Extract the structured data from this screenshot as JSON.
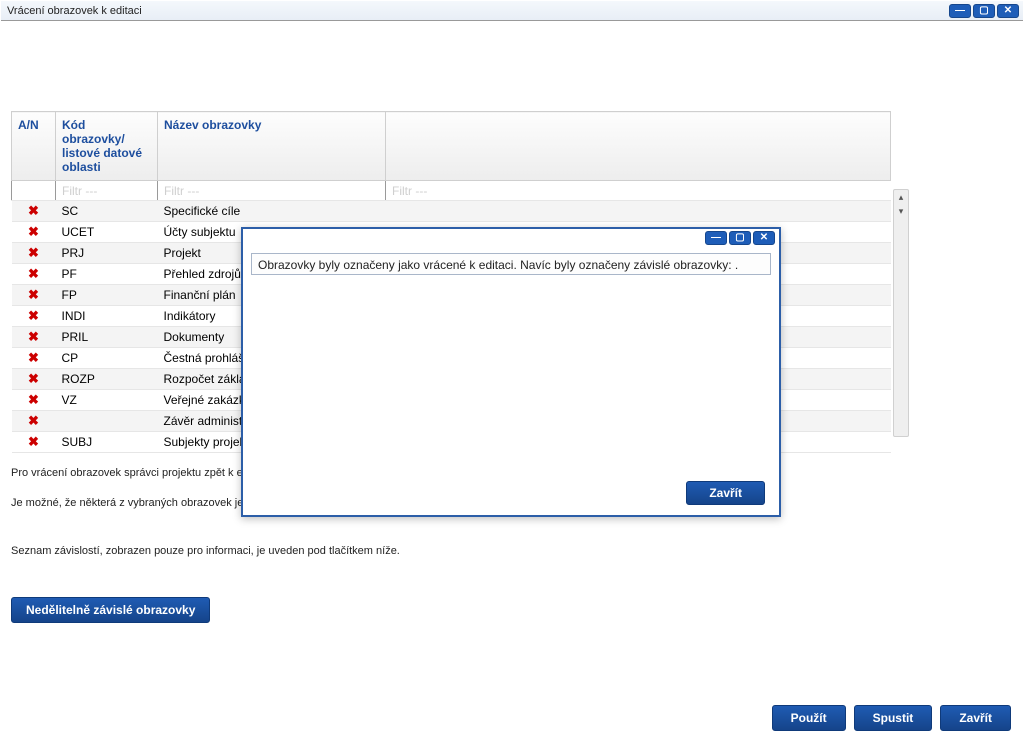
{
  "window": {
    "title": "Vrácení obrazovek k editaci"
  },
  "table": {
    "headers": {
      "an": "A/N",
      "kod": "Kód obrazovky/ listové datové oblasti",
      "nazev": "Název obrazovky"
    },
    "filter_label": "Filtr ---",
    "rows": [
      {
        "mark": "✖",
        "kod": "SC",
        "nazev": "Specifické cíle"
      },
      {
        "mark": "✖",
        "kod": "UCET",
        "nazev": "Účty subjektu"
      },
      {
        "mark": "✖",
        "kod": "PRJ",
        "nazev": "Projekt"
      },
      {
        "mark": "✖",
        "kod": "PF",
        "nazev": "Přehled zdrojů"
      },
      {
        "mark": "✖",
        "kod": "FP",
        "nazev": "Finanční plán"
      },
      {
        "mark": "✖",
        "kod": "INDI",
        "nazev": "Indikátory"
      },
      {
        "mark": "✖",
        "kod": "PRIL",
        "nazev": "Dokumenty"
      },
      {
        "mark": "✖",
        "kod": "CP",
        "nazev": "Čestná prohlášení"
      },
      {
        "mark": "✖",
        "kod": "ROZP",
        "nazev": "Rozpočet základní"
      },
      {
        "mark": "✖",
        "kod": "VZ",
        "nazev": "Veřejné zakázky"
      },
      {
        "mark": "✖",
        "kod": "",
        "nazev": "Závěr administrativního ověření"
      },
      {
        "mark": "✖",
        "kod": "SUBJ",
        "nazev": "Subjekty projektu"
      }
    ]
  },
  "info": {
    "line1": "Pro vrácení obrazovek správci projektu zpět k editaci…",
    "line2": "Je možné, že některá z vybraných obrazovek je nedělitelně…",
    "line3": "Seznam závislostí, zobrazen pouze pro informaci, je uveden pod tlačítkem níže."
  },
  "buttons": {
    "dependent": "Nedělitelně závislé obrazovky",
    "apply": "Použít",
    "run": "Spustit",
    "close": "Zavřít"
  },
  "modal": {
    "message": "Obrazovky byly označeny jako vrácené k editaci. Navíc byly označeny závislé obrazovky:  .",
    "close": "Zavřít"
  },
  "icons": {
    "minimize": "—",
    "maximize": "▢",
    "close": "✕"
  }
}
